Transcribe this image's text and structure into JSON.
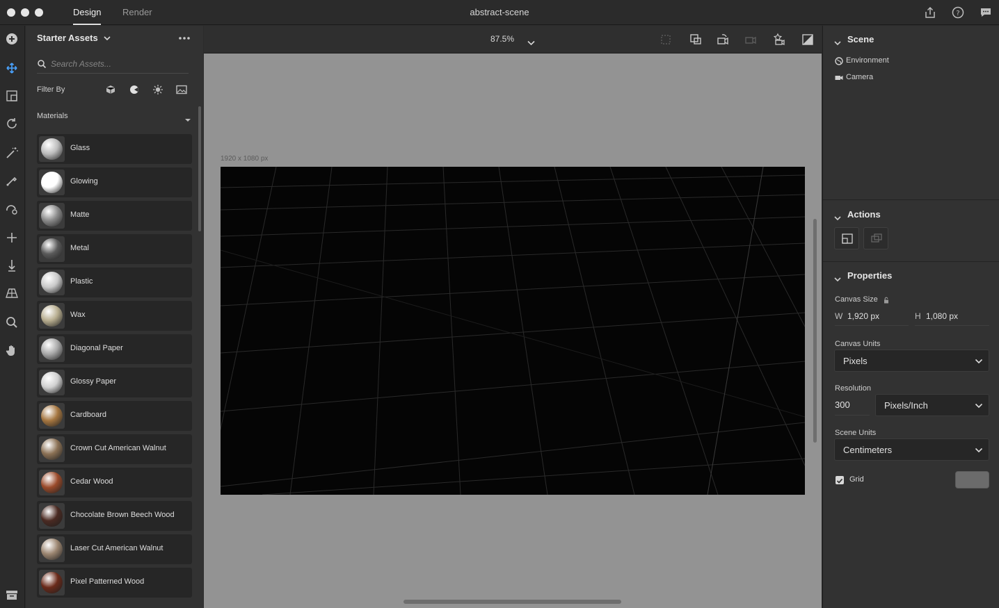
{
  "window": {
    "tabs": [
      {
        "label": "Design",
        "active": true
      },
      {
        "label": "Render",
        "active": false
      }
    ],
    "document_title": "abstract-scene",
    "top_right_icons": [
      "share-icon",
      "help-icon",
      "feedback-icon"
    ]
  },
  "toolbar": {
    "tools": [
      "add-icon",
      "move-icon",
      "select-icon",
      "rotate-icon",
      "magic-wand-icon",
      "eyedropper-icon",
      "sample-icon",
      "axis-move-icon",
      "drop-to-ground-icon",
      "perspective-icon",
      "zoom-icon",
      "hand-icon"
    ],
    "bottom_tool": "archive-icon"
  },
  "assets": {
    "title": "Starter Assets",
    "search_placeholder": "Search Assets...",
    "filter_label": "Filter By",
    "filter_icons": [
      "models-filter-icon",
      "materials-filter-icon",
      "lights-filter-icon",
      "images-filter-icon"
    ],
    "section_label": "Materials",
    "materials": [
      {
        "name": "Glass",
        "color": "#bcbcbc"
      },
      {
        "name": "Glowing",
        "color": "#ffffff"
      },
      {
        "name": "Matte",
        "color": "#8a8a8a"
      },
      {
        "name": "Metal",
        "color": "#5a5a5a"
      },
      {
        "name": "Plastic",
        "color": "#c9c9c9"
      },
      {
        "name": "Wax",
        "color": "#b7ad8f"
      },
      {
        "name": "Diagonal Paper",
        "color": "#a9a9a9"
      },
      {
        "name": "Glossy Paper",
        "color": "#d0d0d0"
      },
      {
        "name": "Cardboard",
        "color": "#a57640"
      },
      {
        "name": "Crown Cut American Walnut",
        "color": "#8b7155"
      },
      {
        "name": "Cedar Wood",
        "color": "#9a4a2a"
      },
      {
        "name": "Chocolate Brown Beech Wood",
        "color": "#4a2a22"
      },
      {
        "name": "Laser Cut American Walnut",
        "color": "#9b8570"
      },
      {
        "name": "Pixel Patterned Wood",
        "color": "#6a2a1a"
      }
    ]
  },
  "canvas": {
    "zoom": "87.5%",
    "size_label": "1920 x 1080 px",
    "toolbar_icons": [
      "frame-icon",
      "fit-selection-icon",
      "camera-orbit-icon",
      "camera-pan-icon",
      "camera-bookmark-icon",
      "render-preview-icon"
    ]
  },
  "scene": {
    "title": "Scene",
    "items": [
      {
        "label": "Environment",
        "icon": "environment-icon"
      },
      {
        "label": "Camera",
        "icon": "camera-icon"
      }
    ]
  },
  "actions": {
    "title": "Actions",
    "buttons": [
      "fit-canvas-action-icon",
      "match-image-action-icon"
    ]
  },
  "properties": {
    "title": "Properties",
    "canvas_size_label": "Canvas Size",
    "width_prefix": "W",
    "width_value": "1,920 px",
    "height_prefix": "H",
    "height_value": "1,080 px",
    "canvas_units_label": "Canvas Units",
    "canvas_units_value": "Pixels",
    "resolution_label": "Resolution",
    "resolution_value": "300",
    "resolution_units_value": "Pixels/Inch",
    "scene_units_label": "Scene Units",
    "scene_units_value": "Centimeters",
    "grid_label": "Grid",
    "grid_checked": true,
    "grid_color": "#6b6b6b"
  }
}
